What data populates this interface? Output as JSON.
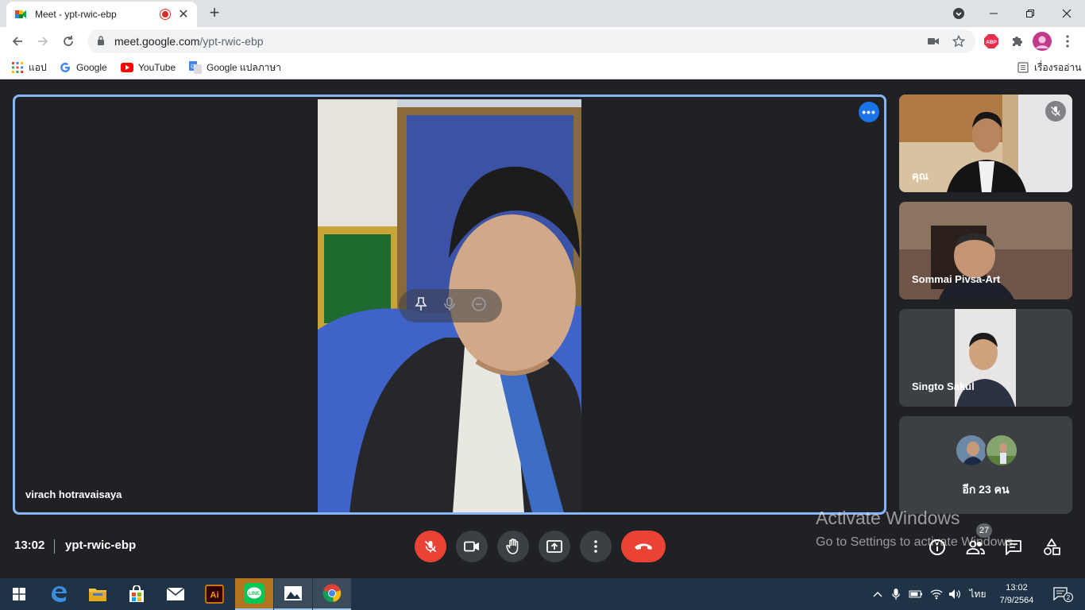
{
  "browser": {
    "tab_title": "Meet - ypt-rwic-ebp",
    "tab_close": "✕",
    "new_tab": "+",
    "url_host": "meet.google.com",
    "url_path": "/ypt-rwic-ebp",
    "abp_label": "ABP",
    "bookmarks": [
      {
        "label": "แอป"
      },
      {
        "label": "Google"
      },
      {
        "label": "YouTube"
      },
      {
        "label": "Google แปลภาษา"
      }
    ],
    "reading_list": "เรื่องรออ่าน"
  },
  "meet": {
    "main_speaker": "virach hotravaisaya",
    "participants": [
      {
        "name": "คุณ"
      },
      {
        "name": "Sommai Pivsa-Art"
      },
      {
        "name": "Singto Sakul"
      }
    ],
    "others_label": "อีก 23 คน",
    "time": "13:02",
    "meeting_code": "ypt-rwic-ebp",
    "people_count": "27",
    "more_dots": "•••"
  },
  "watermark": {
    "line1": "Activate Windows",
    "line2": "Go to Settings to activate Windows."
  },
  "taskbar": {
    "ai_label": "Ai",
    "line_label": "LINE",
    "lang": "ไทย",
    "time": "13:02",
    "date": "7/9/2564",
    "notifications": "2"
  },
  "colors": {
    "accent": "#8ab4f8",
    "end_call": "#ea4335",
    "meet_bg": "#202124"
  }
}
